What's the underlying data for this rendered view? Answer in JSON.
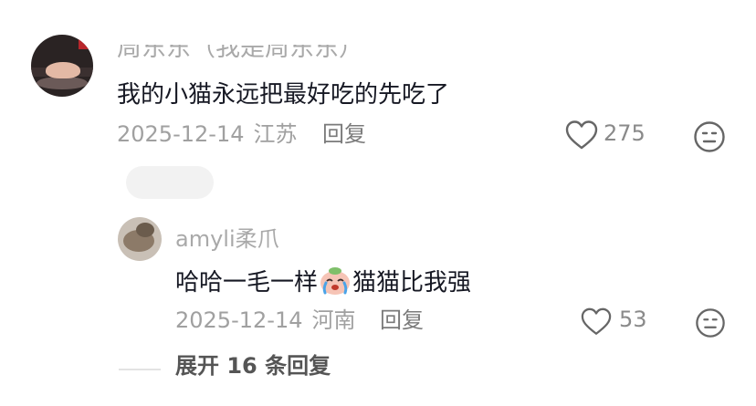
{
  "comments": {
    "top": {
      "username": "周东东（我是周东东）",
      "text": "我的小猫永远把最好吃的先吃了",
      "date": "2025-12-14",
      "region": "江苏",
      "reply_label": "回复",
      "like_count": "275"
    },
    "reply": {
      "username": "amyli柔爪",
      "text_before": "哈哈一毛一样",
      "emoji": "crying-laughing-peach-emoji",
      "text_after": "猫猫比我强",
      "date": "2025-12-14",
      "region": "河南",
      "reply_label": "回复",
      "like_count": "53"
    },
    "expand_label": "展开 16 条回复"
  },
  "colors": {
    "text_primary": "#161823",
    "text_secondary": "#a0a0a0",
    "icon_stroke": "#666666"
  }
}
